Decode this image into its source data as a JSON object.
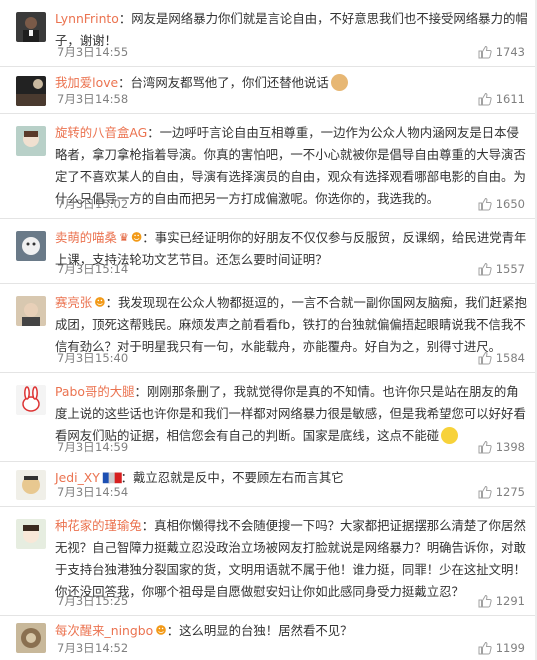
{
  "comments": [
    {
      "username": "LynnFrinto",
      "separator": "：",
      "text": "网友是网络暴力你们就是言论自由，不好意思我们也不接受网络暴力的帽子，谢谢！",
      "date": "7月3日",
      "time": "14:55",
      "likes": "1743"
    },
    {
      "username": "我加爱love",
      "separator": "：",
      "text": "台湾网友都骂他了，你们还替他说话",
      "date": "7月3日",
      "time": "14:58",
      "likes": "1611"
    },
    {
      "username": "旋转的八音盒AG",
      "separator": "：",
      "text": "一边呼吁言论自由互相尊重，一边作为公众人物内涵网友是日本侵略者，拿刀拿枪指着导演。你真的害怕吧，一不小心就被你是倡导自由尊重的大导演否定了不喜欢某人的自由，导演有选择演员的自由，观众有选择观看哪部电影的自由。为什么只倡导一方的自由而把另一方打成偏激呢。你选你的，我选我的。",
      "date": "7月3日",
      "time": "15:02",
      "likes": "1650"
    },
    {
      "username": "卖萌的喵桑",
      "separator": "：",
      "text": "事实已经证明你的好朋友不仅仅参与反服贸，反课纲，给民进党青年上课，支持法轮功文艺节目。还怎么要时间证明？",
      "date": "7月3日",
      "time": "15:14",
      "likes": "1557"
    },
    {
      "username": "赛亮张",
      "separator": "：",
      "text": "我发现现在公众人物都挺逗的，一言不合就一副你国网友脑痴，我们赶紧抱成团，顶死这帮贱民。麻烦发声之前看看fb，铁打的台独就偏偏捂起眼睛说我不信我不信有劲么？对于明星我只有一句，水能载舟，亦能覆舟。好自为之，别得寸进尺。",
      "date": "7月3日",
      "time": "15:40",
      "likes": "1584"
    },
    {
      "username": "Pabo哥的大腿",
      "separator": "：",
      "text": "刚刚那条删了，我就觉得你是真的不知情。也许你只是站在朋友的角度上说的这些话也许你是和我们一样都对网络暴力很是敏感，但是我希望您可以好好看看网友们贴的证据，相信您会有自己的判断。国家是底线，这点不能碰",
      "date": "7月3日",
      "time": "14:59",
      "likes": "1398"
    },
    {
      "username": "Jedi_XY",
      "separator": "：",
      "text": "戴立忍就是反中，不要顾左右而言其它",
      "date": "7月3日",
      "time": "14:54",
      "likes": "1275"
    },
    {
      "username": "种花家的瑾瑜兔",
      "separator": "：",
      "text": "真相你懒得找不会随便搜一下吗？大家都把证据摆那么清楚了你居然无视？自己智障力挺戴立忍没政治立场被网友打脸就说是网络暴力？明确告诉你，对敢于支持台独港独分裂国家的货，文明用语就不属于他！谁力挺，同罪！少在这扯文明！你还没回答我，你哪个祖母是自愿做慰安妇让你如此感同身受力挺戴立忍？",
      "date": "7月3日",
      "time": "15:25",
      "likes": "1291"
    },
    {
      "username": "每次醒来_ningbo",
      "separator": "：",
      "text": "这么明显的台独！居然看不见？",
      "date": "7月3日",
      "time": "14:52",
      "likes": "1199"
    }
  ],
  "colors": {
    "username": "#eb7350",
    "text": "#333333",
    "meta": "#808080",
    "divider": "#e4e4e4"
  },
  "icons": {
    "like": "thumbs-up-icon",
    "crown_badge": "crown-badge-icon",
    "member_badge": "smile-badge-icon",
    "flag": "france-flag-icon",
    "emoji_smile": "smile-emoji-icon",
    "emoji_dog": "dog-emoji-icon"
  }
}
